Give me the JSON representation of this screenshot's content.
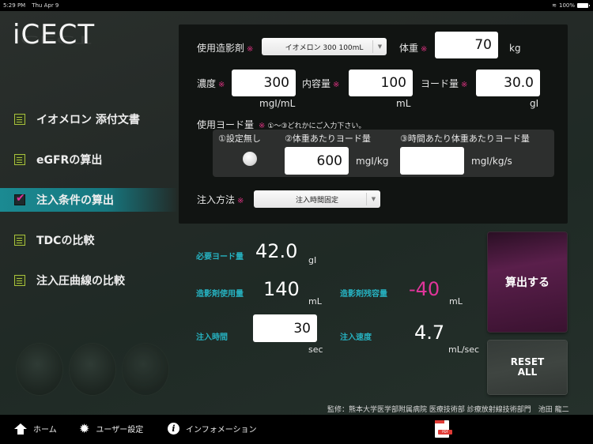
{
  "status_bar": {
    "time": "5:29 PM",
    "date": "Thu Apr 9",
    "battery": "100%"
  },
  "app": {
    "logo": "iCECT"
  },
  "sidebar": {
    "items": [
      {
        "label": "イオメロン 添付文書",
        "icon": "document-icon",
        "active": false
      },
      {
        "label": "eGFRの算出",
        "icon": "calculator-icon",
        "active": false
      },
      {
        "label": "注入条件の算出",
        "icon": "checkbox-checked-icon",
        "active": true
      },
      {
        "label": "TDCの比較",
        "icon": "chart-icon",
        "active": false
      },
      {
        "label": "注入圧曲線の比較",
        "icon": "chart-icon",
        "active": false
      }
    ]
  },
  "form": {
    "required_mark": "※",
    "contrast_agent": {
      "label": "使用造影剤",
      "value": "イオメロン 300 100mL"
    },
    "weight": {
      "label": "体重",
      "value": "70",
      "unit": "kg"
    },
    "concentration": {
      "label": "濃度",
      "value": "300",
      "unit": "mgI/mL"
    },
    "volume": {
      "label": "内容量",
      "value": "100",
      "unit": "mL"
    },
    "iodine_amount": {
      "label": "ヨード量",
      "value": "30.0",
      "unit": "gI"
    },
    "iodine_usage": {
      "label": "使用ヨード量",
      "note": "①〜③どれかにご入力下さい。",
      "option1": {
        "label": "①設定無し"
      },
      "option2": {
        "label": "②体重あたりヨード量",
        "value": "600",
        "unit": "mgI/kg"
      },
      "option3": {
        "label": "③時間あたり体重あたりヨード量",
        "value": "",
        "unit": "mgI/kg/s"
      }
    },
    "injection_method": {
      "label": "注入方法",
      "value": "注入時間固定"
    }
  },
  "results": {
    "required_iodine": {
      "label": "必要ヨード量",
      "value": "42.0",
      "unit": "gI"
    },
    "agent_used": {
      "label": "造影剤使用量",
      "value": "140",
      "unit": "mL"
    },
    "agent_remaining": {
      "label": "造影剤残容量",
      "value": "-40",
      "unit": "mL",
      "color": "#e0359a"
    },
    "injection_time": {
      "label": "注入時間",
      "value": "30",
      "unit": "sec"
    },
    "injection_rate": {
      "label": "注入速度",
      "value": "4.7",
      "unit": "mL/sec"
    }
  },
  "buttons": {
    "calculate": "算出する",
    "reset_line1": "RESET",
    "reset_line2": "ALL"
  },
  "credit": "監修：熊本大学医学部附属病院 医療技術部 診療放射線技術部門　池田 龍二",
  "tabbar": {
    "home": "ホーム",
    "user_settings": "ユーザー設定",
    "information": "インフォメーション",
    "pdf": "PDF"
  },
  "colors": {
    "accent_teal": "#1b8a92",
    "required_pink": "#d8327f",
    "label_teal": "#26b1c0",
    "calc_purple": "#5a1f4b",
    "icon_green": "#a8c23c"
  }
}
